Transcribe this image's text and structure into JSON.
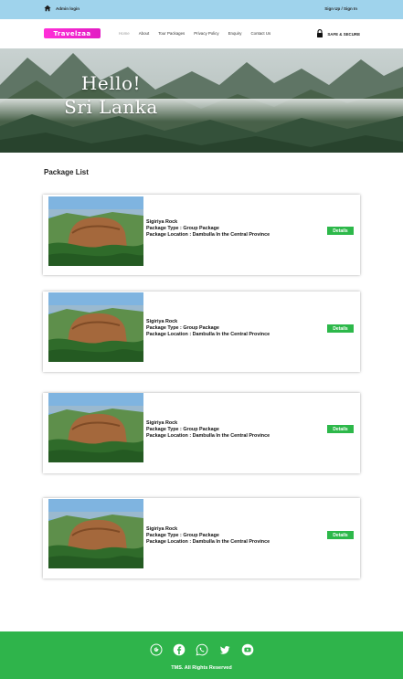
{
  "topbar": {
    "admin_label": "Admin login",
    "signup_label": "Sign Up / Sign In"
  },
  "nav": {
    "logo_text": "Travelzaa",
    "items": [
      "Home",
      "About",
      "Tour Packages",
      "Privacy Policy",
      "Enquiry",
      "Contact Us"
    ],
    "active_item": "Home",
    "secure_label": "SAFE & SECURE"
  },
  "hero": {
    "line1": "Hello!",
    "line2": "Sri Lanka"
  },
  "packages_title": "Package List",
  "packages": [
    {
      "name": "Sigiriya Rock",
      "type": "Package Type : Group Package",
      "location": "Package Location : Dambulla In the Central Province",
      "button": "Details"
    },
    {
      "name": "Sigiriya Rock",
      "type": "Package Type : Group Package",
      "location": "Package Location : Dambulla In the Central Province",
      "button": "Details"
    },
    {
      "name": "Sigiriya Rock",
      "type": "Package Type : Group Package",
      "location": "Package Location : Dambulla In the Central Province",
      "button": "Details"
    },
    {
      "name": "Sigiriya Rock",
      "type": "Package Type : Group Package",
      "location": "Package Location : Dambulla In the Central Province",
      "button": "Details"
    }
  ],
  "footer": {
    "social_icons": [
      "google-icon",
      "facebook-icon",
      "whatsapp-icon",
      "twitter-icon",
      "youtube-icon"
    ],
    "copyright": "TMS. All Rights Reserved"
  },
  "colors": {
    "topbar": "#9fd3ec",
    "logo": "#ff2fd8",
    "button": "#2db84a",
    "footer": "#2fb44b"
  }
}
